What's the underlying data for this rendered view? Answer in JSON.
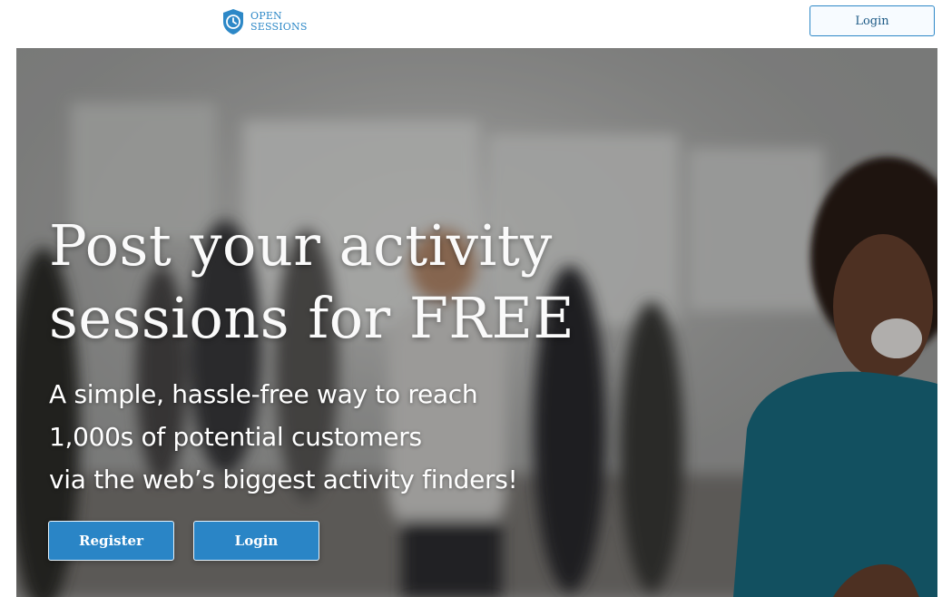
{
  "header": {
    "logo_line1": "OPEN",
    "logo_line2": "SESSIONS",
    "login_label": "Login"
  },
  "hero": {
    "headline_line1": "Post your activity",
    "headline_line2": "sessions for FREE",
    "subtext_line1": "A simple, hassle-free way to reach",
    "subtext_line2": "1,000s of potential customers",
    "subtext_line3": "via the web’s biggest activity finders!",
    "register_label": "Register",
    "login_label": "Login"
  },
  "colors": {
    "accent": "#2a85c6",
    "logo_blue": "#2d88c7",
    "top_swatch": "#ffffff",
    "shirt_teal": "#1a6f86"
  },
  "icons": {
    "logo_icon": "shield-clock-icon"
  }
}
